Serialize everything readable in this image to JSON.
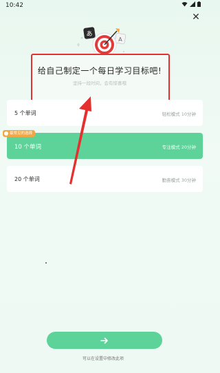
{
  "status": {
    "time": "10:42"
  },
  "panel": {
    "title": "给自己制定一个每日学习目标吧!",
    "subtitle": "坚持一段时间，会有惊喜哦"
  },
  "hero": {
    "card_char": "あ",
    "card_char_2": "A"
  },
  "badge": {
    "label": "最常见的选择"
  },
  "options": [
    {
      "count": "5 个单词",
      "mode": "轻松模式 10分钟"
    },
    {
      "count": "10 个单词",
      "mode": "专注模式 20分钟"
    },
    {
      "count": "20 个单词",
      "mode": "勤奋模式 30分钟"
    }
  ],
  "next_icon": "arrow-right-icon",
  "hint": "可以在设置中修改此项",
  "colors": {
    "accent": "#5dd39a",
    "badge": "#f2a744",
    "annotation": "#e53030"
  }
}
